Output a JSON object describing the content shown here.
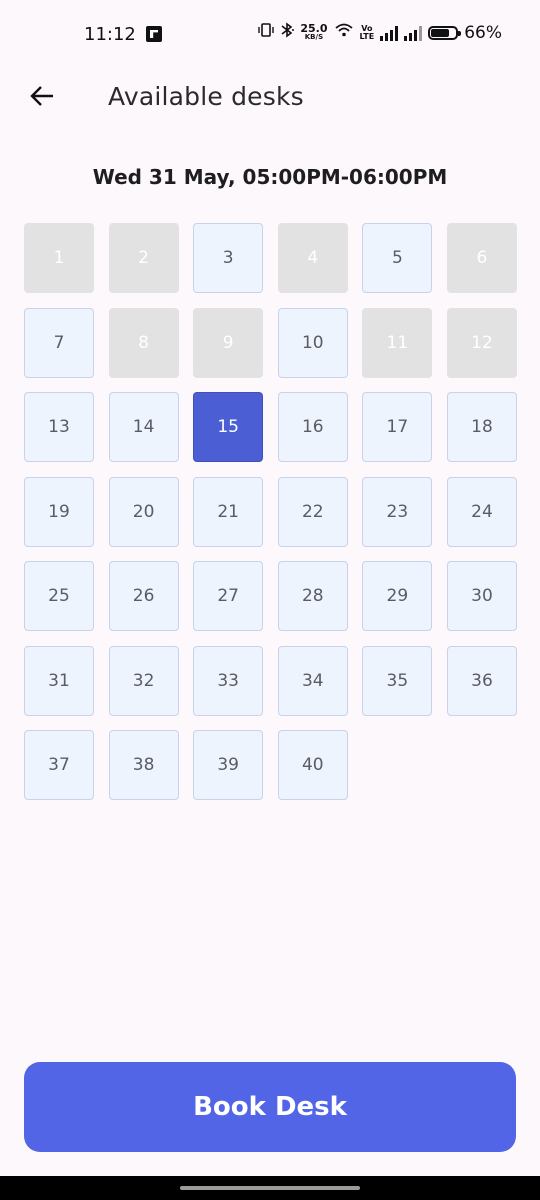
{
  "status_bar": {
    "time": "11:12",
    "net_speed_value": "25.0",
    "net_speed_unit": "KB/S",
    "volte_top": "Vo",
    "volte_bottom": "LTE",
    "battery_text": "66%",
    "icons": [
      "app-notification-icon",
      "vibrate-icon",
      "bluetooth-icon",
      "wifi-icon",
      "volte-icon",
      "signal-icon",
      "signal-icon",
      "battery-icon"
    ]
  },
  "header": {
    "back_icon": "arrow-left-icon",
    "title": "Available desks"
  },
  "date_heading": "Wed 31 May, 05:00PM-06:00PM",
  "desks": [
    {
      "label": "1",
      "state": "unavailable"
    },
    {
      "label": "2",
      "state": "unavailable"
    },
    {
      "label": "3",
      "state": "available"
    },
    {
      "label": "4",
      "state": "unavailable"
    },
    {
      "label": "5",
      "state": "available"
    },
    {
      "label": "6",
      "state": "unavailable"
    },
    {
      "label": "7",
      "state": "available"
    },
    {
      "label": "8",
      "state": "unavailable"
    },
    {
      "label": "9",
      "state": "unavailable"
    },
    {
      "label": "10",
      "state": "available"
    },
    {
      "label": "11",
      "state": "unavailable"
    },
    {
      "label": "12",
      "state": "unavailable"
    },
    {
      "label": "13",
      "state": "available"
    },
    {
      "label": "14",
      "state": "available"
    },
    {
      "label": "15",
      "state": "selected"
    },
    {
      "label": "16",
      "state": "available"
    },
    {
      "label": "17",
      "state": "available"
    },
    {
      "label": "18",
      "state": "available"
    },
    {
      "label": "19",
      "state": "available"
    },
    {
      "label": "20",
      "state": "available"
    },
    {
      "label": "21",
      "state": "available"
    },
    {
      "label": "22",
      "state": "available"
    },
    {
      "label": "23",
      "state": "available"
    },
    {
      "label": "24",
      "state": "available"
    },
    {
      "label": "25",
      "state": "available"
    },
    {
      "label": "26",
      "state": "available"
    },
    {
      "label": "27",
      "state": "available"
    },
    {
      "label": "28",
      "state": "available"
    },
    {
      "label": "29",
      "state": "available"
    },
    {
      "label": "30",
      "state": "available"
    },
    {
      "label": "31",
      "state": "available"
    },
    {
      "label": "32",
      "state": "available"
    },
    {
      "label": "33",
      "state": "available"
    },
    {
      "label": "34",
      "state": "available"
    },
    {
      "label": "35",
      "state": "available"
    },
    {
      "label": "36",
      "state": "available"
    },
    {
      "label": "37",
      "state": "available"
    },
    {
      "label": "38",
      "state": "available"
    },
    {
      "label": "39",
      "state": "available"
    },
    {
      "label": "40",
      "state": "available"
    }
  ],
  "book_button_label": "Book Desk",
  "colors": {
    "accent": "#5165e6",
    "selected_desk": "#4b5ed4",
    "available_desk": "#eef4fd",
    "unavailable_desk": "#e2e2e2",
    "background": "#fdf8fb"
  }
}
